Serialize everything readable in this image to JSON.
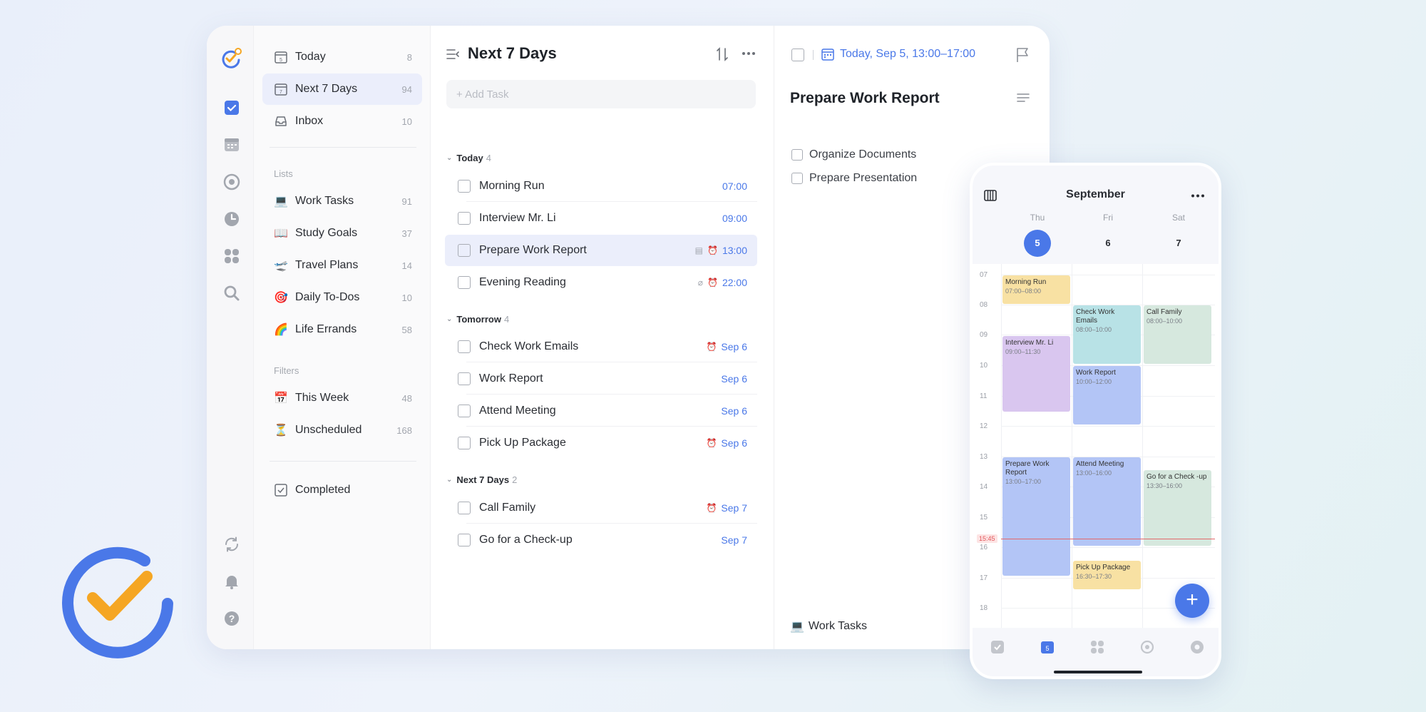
{
  "colors": {
    "accent": "#4a78e8",
    "logo_orange": "#f5a623",
    "selected_row": "#ebeefb"
  },
  "sidebar": {
    "smart_lists": [
      {
        "label": "Today",
        "count": "8",
        "icon": "calendar-day-icon"
      },
      {
        "label": "Next 7 Days",
        "count": "94",
        "icon": "calendar-week-icon",
        "active": true
      },
      {
        "label": "Inbox",
        "count": "10",
        "icon": "inbox-icon"
      }
    ],
    "lists_header": "Lists",
    "lists": [
      {
        "label": "Work Tasks",
        "count": "91",
        "emoji": "💻"
      },
      {
        "label": "Study Goals",
        "count": "37",
        "emoji": "📖"
      },
      {
        "label": "Travel Plans",
        "count": "14",
        "emoji": "🛫"
      },
      {
        "label": "Daily To-Dos",
        "count": "10",
        "emoji": "🎯"
      },
      {
        "label": "Life Errands",
        "count": "58",
        "emoji": "🌈"
      }
    ],
    "filters_header": "Filters",
    "filters": [
      {
        "label": "This Week",
        "count": "48",
        "emoji": "📅"
      },
      {
        "label": "Unscheduled",
        "count": "168",
        "emoji": "⏳"
      }
    ],
    "completed": "Completed"
  },
  "tasklist": {
    "title": "Next 7 Days",
    "add_placeholder": "+ Add Task",
    "groups": [
      {
        "name": "Today",
        "count": "4",
        "tasks": [
          {
            "title": "Morning Run",
            "meta": "07:00"
          },
          {
            "title": "Interview Mr. Li",
            "meta": "09:00"
          },
          {
            "title": "Prepare Work Report",
            "meta": "13:00",
            "selected": true
          },
          {
            "title": "Evening Reading",
            "meta": "22:00"
          }
        ]
      },
      {
        "name": "Tomorrow",
        "count": "4",
        "tasks": [
          {
            "title": "Check Work Emails",
            "meta": "Sep 6"
          },
          {
            "title": "Work Report",
            "meta": "Sep 6"
          },
          {
            "title": "Attend Meeting",
            "meta": "Sep 6"
          },
          {
            "title": "Pick Up Package",
            "meta": "Sep 6"
          }
        ]
      },
      {
        "name": "Next 7 Days",
        "count": "2",
        "tasks": [
          {
            "title": "Call Family",
            "meta": "Sep 7"
          },
          {
            "title": "Go for a Check-up",
            "meta": "Sep 7"
          }
        ]
      }
    ]
  },
  "detail": {
    "date": "Today, Sep 5, 13:00–17:00",
    "title": "Prepare Work Report",
    "subtasks": [
      "Organize Documents",
      "Prepare Presentation"
    ],
    "list_name": "Work Tasks",
    "list_emoji": "💻"
  },
  "phone": {
    "month": "September",
    "days": [
      {
        "dow": "Thu",
        "num": "5"
      },
      {
        "dow": "Fri",
        "num": "6"
      },
      {
        "dow": "Sat",
        "num": "7"
      }
    ],
    "hours": [
      "07",
      "08",
      "09",
      "10",
      "11",
      "12",
      "13",
      "14",
      "15",
      "16",
      "17",
      "18"
    ],
    "now": "15:45",
    "events": {
      "e1": {
        "title": "Morning Run",
        "time": "07:00–08:00"
      },
      "e2": {
        "title": "Interview Mr. Li",
        "time": "09:00–11:30"
      },
      "e3": {
        "title": "Prepare Work Report",
        "time": "13:00–17:00"
      },
      "e4": {
        "title": "Check Work Emails",
        "time": "08:00–10:00"
      },
      "e5": {
        "title": "Work Report",
        "time": "10:00–12:00"
      },
      "e6": {
        "title": "Attend Meeting",
        "time": "13:00–16:00"
      },
      "e7": {
        "title": "Pick Up Package",
        "time": "16:30–17:30"
      },
      "e8": {
        "title": "Call Family",
        "time": "08:00–10:00"
      },
      "e9": {
        "title": "Go for a Check -up",
        "time": "13:30–16:00"
      }
    },
    "fab": "+",
    "tab_badge": "5"
  }
}
